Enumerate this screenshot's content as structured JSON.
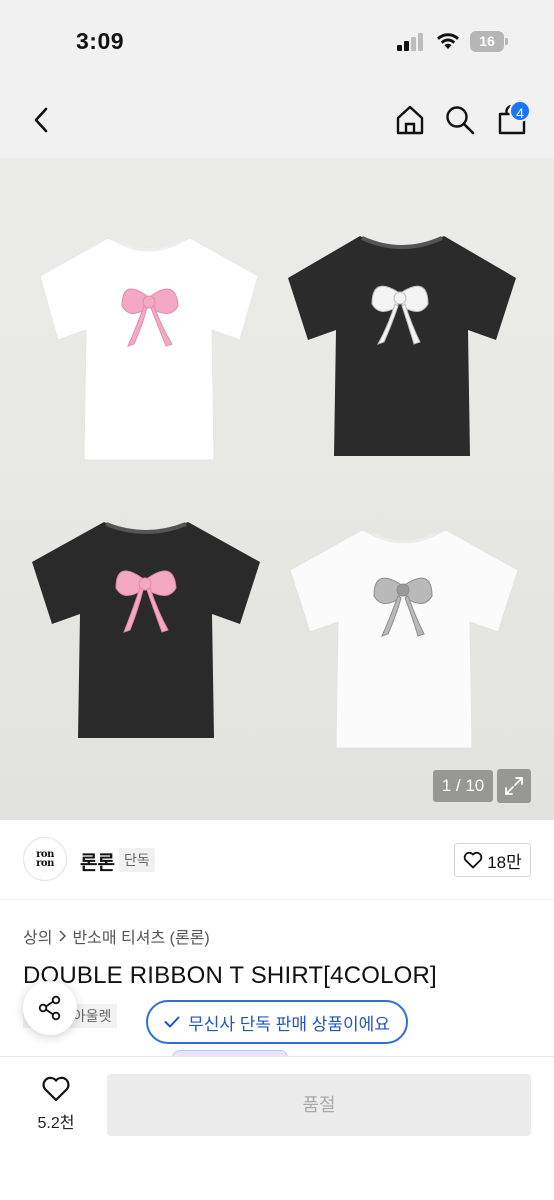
{
  "status_bar": {
    "time": "3:09",
    "battery": "16"
  },
  "nav": {
    "cart_count": "4"
  },
  "gallery": {
    "counter": "1 / 10"
  },
  "brand": {
    "logo_line1": "ron",
    "logo_line2": "ron",
    "name": "론론",
    "tag": "단독"
  },
  "like": {
    "count": "18만"
  },
  "breadcrumb": {
    "category": "상의",
    "subcategory": "반소매 티셔츠 (론론)"
  },
  "product": {
    "title": "DOUBLE RIBBON T SHIRT[4COLOR]",
    "tags": [
      "단독",
      "아울렛"
    ]
  },
  "toast": {
    "text": "무신사 단독 판매 상품이에요"
  },
  "bottom": {
    "wish_count": "5.2천",
    "buy_label": "품절"
  },
  "colors": {
    "accent": "#1a73ff",
    "toast_border": "#2f6fd6",
    "disabled_bg": "#ececec"
  },
  "icons": [
    "back-icon",
    "home-icon",
    "search-icon",
    "bag-icon",
    "expand-icon",
    "heart-icon",
    "share-icon",
    "check-icon"
  ]
}
